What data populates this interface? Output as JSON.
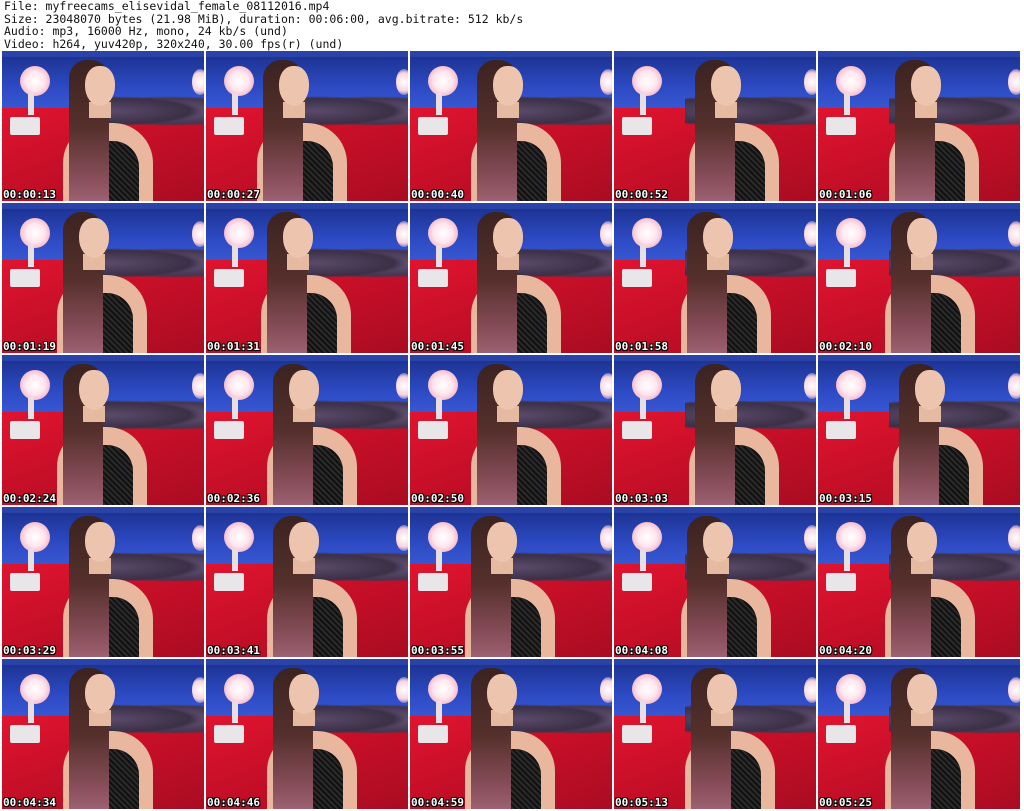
{
  "header": {
    "file": "File: myfreecams_elisevidal_female_08112016.mp4",
    "size": "Size: 23048070 bytes (21.98 MiB), duration: 00:06:00, avg.bitrate: 512 kb/s",
    "audio": "Audio: mp3, 16000 Hz, mono, 24 kb/s (und)",
    "video": "Video: h264, yuv420p, 320x240, 30.00 fps(r) (und)"
  },
  "thumbnails": [
    "00:00:13",
    "00:00:27",
    "00:00:40",
    "00:00:52",
    "00:01:06",
    "00:01:19",
    "00:01:31",
    "00:01:45",
    "00:01:58",
    "00:02:10",
    "00:02:24",
    "00:02:36",
    "00:02:50",
    "00:03:03",
    "00:03:15",
    "00:03:29",
    "00:03:41",
    "00:03:55",
    "00:04:08",
    "00:04:20",
    "00:04:34",
    "00:04:46",
    "00:04:59",
    "00:05:13",
    "00:05:25"
  ]
}
